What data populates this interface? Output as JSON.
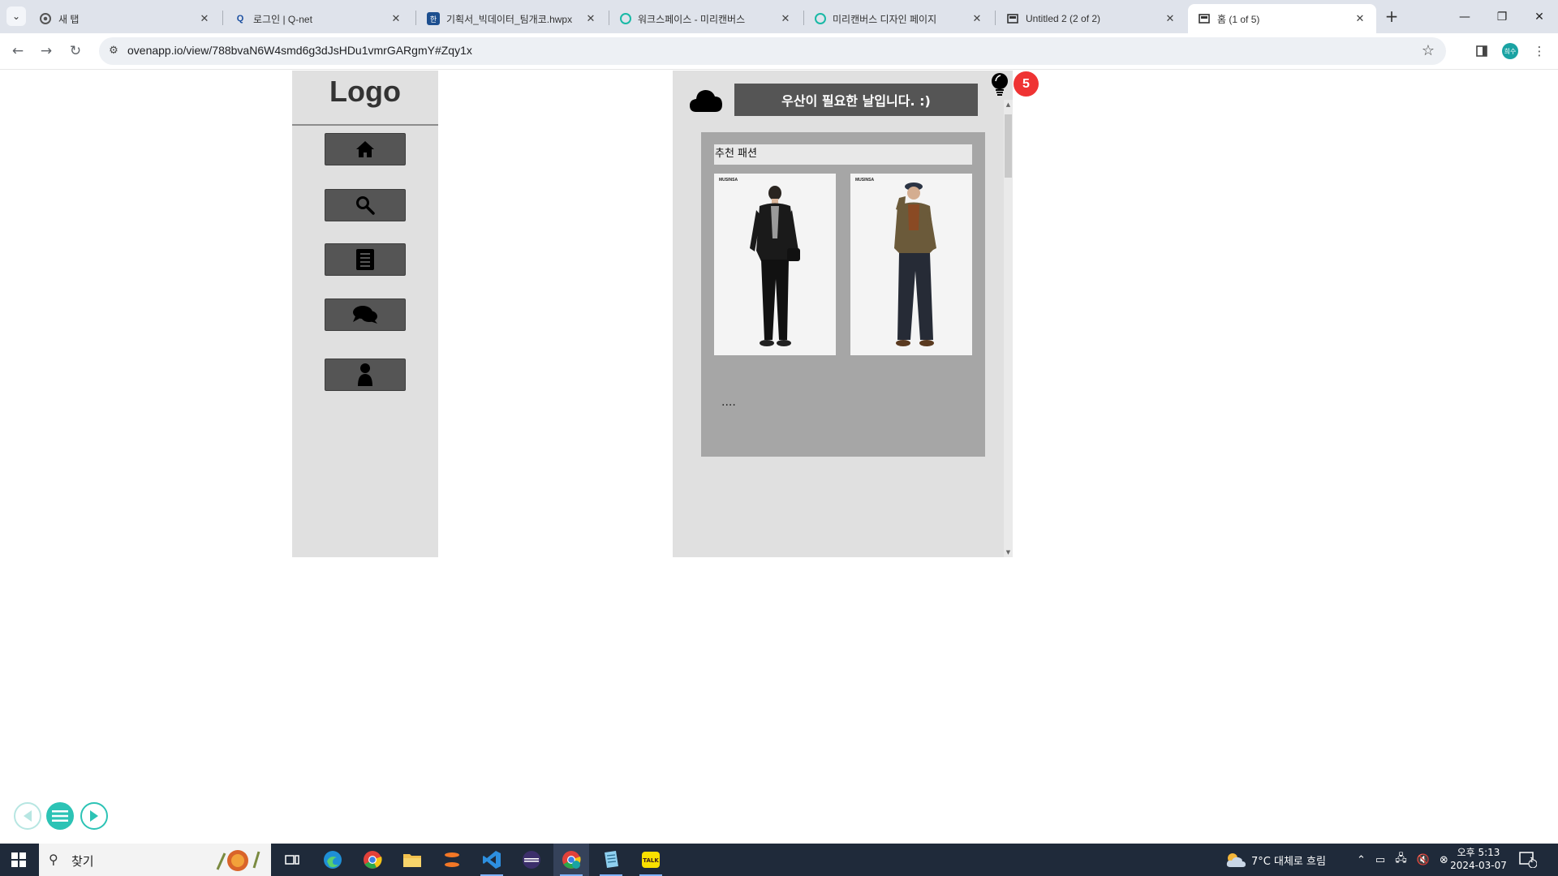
{
  "browser": {
    "tabs": [
      {
        "title": "새 탭",
        "favicon": "chrome-icon",
        "active": false
      },
      {
        "title": "로그인 | Q-net",
        "favicon": "qnet-icon",
        "active": false
      },
      {
        "title": "기획서_빅데이터_팀개코.hwpx",
        "favicon": "hwp-icon",
        "active": false
      },
      {
        "title": "워크스페이스 - 미리캔버스",
        "favicon": "miricanvas-icon",
        "active": false
      },
      {
        "title": "미리캔버스 디자인 페이지",
        "favicon": "miricanvas-icon",
        "active": false
      },
      {
        "title": "Untitled 2 (2 of 2)",
        "favicon": "oven-icon",
        "active": false
      },
      {
        "title": "홈 (1 of 5)",
        "favicon": "oven-icon",
        "active": true
      }
    ],
    "url": "ovenapp.io/view/788bvaN6W4smd6g3dJsHDu1vmrGARgmY#Zqy1x",
    "profile_initial": "희수"
  },
  "app": {
    "logo_text": "Logo",
    "nav": [
      {
        "id": "home",
        "icon": "home-icon"
      },
      {
        "id": "search",
        "icon": "search-icon"
      },
      {
        "id": "document",
        "icon": "document-icon"
      },
      {
        "id": "chat",
        "icon": "chat-icon"
      },
      {
        "id": "profile",
        "icon": "user-icon"
      }
    ],
    "weather_icon": "cloud-icon",
    "weather_message": "우산이 필요한 날입니다. :)",
    "notification_icon": "lightbulb-icon",
    "notification_count": "5",
    "recommend": {
      "title": "추천 패션",
      "items": [
        {
          "brand": "MUSINSA",
          "image": "man-black-jacket-outfit"
        },
        {
          "brand": "MUSINSA",
          "image": "man-brown-jacket-beret-outfit"
        }
      ],
      "more_text": "...."
    }
  },
  "presentation_controls": [
    "prev-icon",
    "menu-icon",
    "play-icon"
  ],
  "taskbar": {
    "search_placeholder": "찾기",
    "weather": "7°C  대체로 흐림",
    "time": "오후 5:13",
    "date": "2024-03-07",
    "notification_count": "1"
  },
  "colors": {
    "sidebar_bg": "#e0e0e0",
    "button_bg": "#555555",
    "panel_bg": "#a6a6a6",
    "badge_red": "#ef3333"
  }
}
